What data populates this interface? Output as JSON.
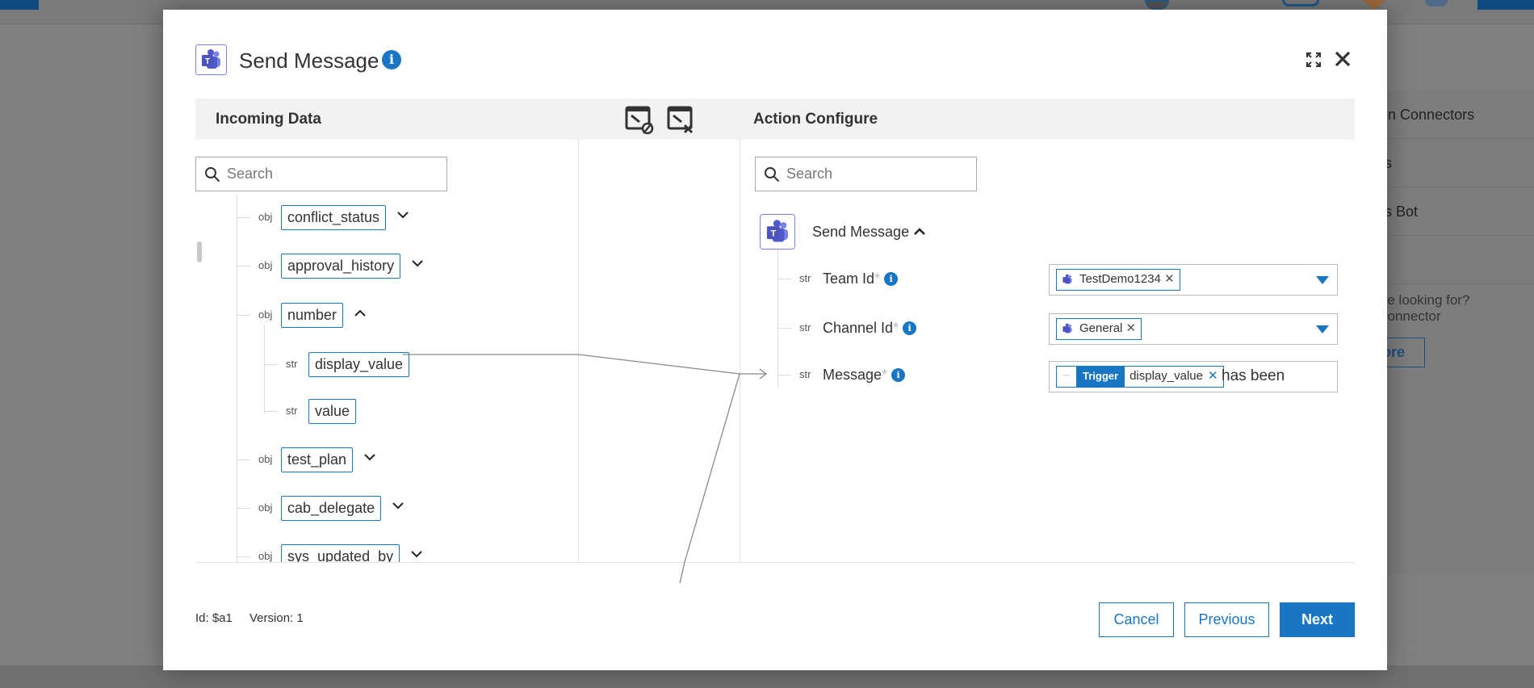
{
  "background": {
    "side_items": [
      "tion Connectors",
      "ms",
      "ms Bot"
    ],
    "side_prompt_line1": "u're looking for?",
    "side_prompt_line2": "connector",
    "side_button": "nore"
  },
  "modal": {
    "title": "Send Message",
    "icons": {
      "app": "teams-icon",
      "info": "info-icon",
      "expand": "expand-icon",
      "close": "close-icon"
    },
    "incoming": {
      "header": "Incoming Data",
      "search_placeholder": "Search",
      "nodes": [
        {
          "type": "obj",
          "name": "conflict_status",
          "state": "collapsed"
        },
        {
          "type": "obj",
          "name": "approval_history",
          "state": "collapsed"
        },
        {
          "type": "obj",
          "name": "number",
          "state": "expanded"
        },
        {
          "type": "str",
          "name": "display_value",
          "child": true
        },
        {
          "type": "str",
          "name": "value",
          "child": true
        },
        {
          "type": "obj",
          "name": "test_plan",
          "state": "collapsed"
        },
        {
          "type": "obj",
          "name": "cab_delegate",
          "state": "collapsed"
        },
        {
          "type": "obj",
          "name": "sys_updated_by",
          "state": "collapsed"
        }
      ]
    },
    "action": {
      "header": "Action Configure",
      "search_placeholder": "Search",
      "group": "Send Message",
      "fields": [
        {
          "type": "str",
          "label": "Team Id",
          "required": "*",
          "chip": "TestDemo1234"
        },
        {
          "type": "str",
          "label": "Channel Id",
          "required": "*",
          "chip": "General"
        },
        {
          "type": "str",
          "label": "Message",
          "required": "*",
          "trigger": "Trigger",
          "chip": "display_value",
          "text": "has been"
        }
      ]
    },
    "footer": {
      "id": "Id: $a1",
      "version": "Version: 1",
      "cancel": "Cancel",
      "previous": "Previous",
      "next": "Next"
    },
    "accent": "#1976c5"
  }
}
